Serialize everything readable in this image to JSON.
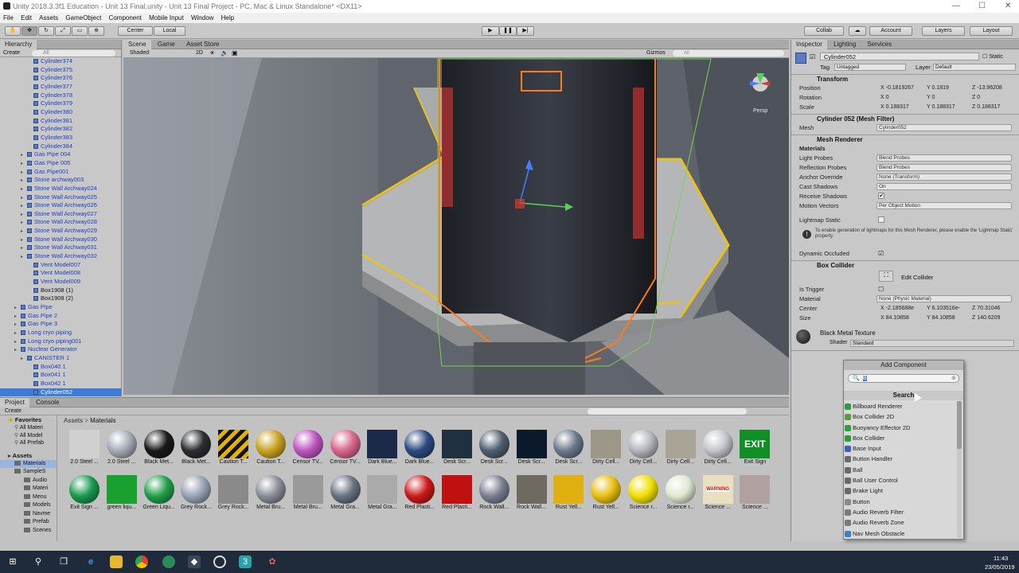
{
  "window": {
    "title": "Unity 2018.3.3f1 Education - Unit 13 Final.unity - Unit 13 Final Project - PC, Mac & Linux Standalone* <DX11>"
  },
  "menu": [
    "File",
    "Edit",
    "Assets",
    "GameObject",
    "Component",
    "Mobile Input",
    "Window",
    "Help"
  ],
  "toolbar": {
    "pivot": "Center",
    "space": "Local",
    "collab": "Collab",
    "account": "Account",
    "layers": "Layers",
    "layout": "Layout"
  },
  "hierarchy": {
    "tab": "Hierarchy",
    "create": "Create",
    "search_placeholder": "All",
    "items": [
      {
        "label": "Cylinder374",
        "indent": 3
      },
      {
        "label": "Cylinder375",
        "indent": 3
      },
      {
        "label": "Cylinder376",
        "indent": 3
      },
      {
        "label": "Cylinder377",
        "indent": 3
      },
      {
        "label": "Cylinder378",
        "indent": 3
      },
      {
        "label": "Cylinder379",
        "indent": 3
      },
      {
        "label": "Cylinder380",
        "indent": 3
      },
      {
        "label": "Cylinder381",
        "indent": 3
      },
      {
        "label": "Cylinder382",
        "indent": 3
      },
      {
        "label": "Cylinder383",
        "indent": 3
      },
      {
        "label": "Cylinder384",
        "indent": 3
      },
      {
        "label": "Gas Pipe 004",
        "indent": 2
      },
      {
        "label": "Gas Pipe 005",
        "indent": 2
      },
      {
        "label": "Gas Pipe001",
        "indent": 2
      },
      {
        "label": "Stone archway003",
        "indent": 2
      },
      {
        "label": "Stone Wall Archway024",
        "indent": 2
      },
      {
        "label": "Stone Wall Archway025",
        "indent": 2
      },
      {
        "label": "Stone Wall Archway026",
        "indent": 2
      },
      {
        "label": "Stone Wall Archway027",
        "indent": 2
      },
      {
        "label": "Stone Wall Archway028",
        "indent": 2
      },
      {
        "label": "Stone Wall Archway029",
        "indent": 2
      },
      {
        "label": "Stone Wall Archway030",
        "indent": 2
      },
      {
        "label": "Stone Wall Archway031",
        "indent": 2
      },
      {
        "label": "Stone Wall Archway032",
        "indent": 2
      },
      {
        "label": "Vent Model007",
        "indent": 3
      },
      {
        "label": "Vent Model008",
        "indent": 3
      },
      {
        "label": "Vent Model009",
        "indent": 3
      },
      {
        "label": "Box1908 (1)",
        "indent": 3
      },
      {
        "label": "Box1908 (2)",
        "indent": 3
      },
      {
        "label": "Gas Pipe",
        "indent": 1
      },
      {
        "label": "Gas Pipe 2",
        "indent": 1
      },
      {
        "label": "Gas Pipe 3",
        "indent": 1
      },
      {
        "label": "Long cryo piping",
        "indent": 1
      },
      {
        "label": "Long cryo piping001",
        "indent": 1
      },
      {
        "label": "Nuclear Generator",
        "indent": 1
      },
      {
        "label": "CANISTER 1",
        "indent": 2
      },
      {
        "label": "Box040 1",
        "indent": 3
      },
      {
        "label": "Box041 1",
        "indent": 3
      },
      {
        "label": "Box042 1",
        "indent": 3
      },
      {
        "label": "Cylinder052",
        "indent": 3
      }
    ]
  },
  "scene": {
    "tabs": [
      "Scene",
      "Game",
      "Asset Store"
    ],
    "shading": "Shaded",
    "mode2d": "2D",
    "gizmos": "Gizmos",
    "search_placeholder": "All",
    "persp": "Persp"
  },
  "project": {
    "tabs": [
      "Project",
      "Console"
    ],
    "create": "Create",
    "breadcrumb_root": "Assets",
    "breadcrumb_sep": ">",
    "breadcrumb_current": "Materials",
    "favorites_label": "Favorites",
    "favorites": [
      "All Materi",
      "All Model",
      "All Prefab"
    ],
    "assets_label": "Assets",
    "asset_folders": [
      "Materials",
      "SampleS",
      "Audio",
      "Materi",
      "Menu",
      "Models",
      "Navme",
      "Prefab",
      "Scenes"
    ],
    "materials_row1": [
      {
        "label": "2.0 Steel ...",
        "color": "#d0d0d0"
      },
      {
        "label": "2.0 Steel ...",
        "color": "#a6acb5"
      },
      {
        "label": "Black Met...",
        "color": "#1a1a1a"
      },
      {
        "label": "Black Met...",
        "color": "#2b2d31"
      },
      {
        "label": "Caution T...",
        "color": "#e0b400"
      },
      {
        "label": "Caution T...",
        "color": "#c9a320"
      },
      {
        "label": "Censor TV...",
        "color": "#c056c0"
      },
      {
        "label": "Censor TV...",
        "color": "#d9668c"
      },
      {
        "label": "Dark Blue...",
        "color": "#1c2a4a"
      },
      {
        "label": "Dark Blue...",
        "color": "#2c4a80"
      },
      {
        "label": "Desk Scr...",
        "color": "#203040"
      },
      {
        "label": "Desk Scr...",
        "color": "#506070"
      },
      {
        "label": "Desk Scr...",
        "color": "#0a1a2a"
      },
      {
        "label": "Desk Scr...",
        "color": "#6b7a8c"
      },
      {
        "label": "Dirty Cell...",
        "color": "#9c9888"
      },
      {
        "label": "Dirty Cell...",
        "color": "#b4b6bc"
      },
      {
        "label": "Dirty Cell...",
        "color": "#a8a596"
      },
      {
        "label": "Dirty Cell...",
        "color": "#c4c6cc"
      },
      {
        "label": "Exit Sign",
        "color": "#0f8f24"
      }
    ],
    "materials_row2": [
      {
        "label": "Exit Sign ...",
        "color": "#1a9a50"
      },
      {
        "label": "green liqu...",
        "color": "#1aa030"
      },
      {
        "label": "Green Liqu...",
        "color": "#22a04a"
      },
      {
        "label": "Grey Rock...",
        "color": "#9aa2b4"
      },
      {
        "label": "Grey Rock...",
        "color": "#8a8a8a"
      },
      {
        "label": "Metal Bru...",
        "color": "#8a8e96"
      },
      {
        "label": "Metal Bru...",
        "color": "#9a9a9a"
      },
      {
        "label": "Metal Gra...",
        "color": "#6a7282"
      },
      {
        "label": "Metal Gra...",
        "color": "#aaaaaa"
      },
      {
        "label": "Red Plasti...",
        "color": "#cc1a1a"
      },
      {
        "label": "Red Plasti...",
        "color": "#c01010"
      },
      {
        "label": "Rock Wall...",
        "color": "#7a8090"
      },
      {
        "label": "Rock Wall...",
        "color": "#6e6a62"
      },
      {
        "label": "Rust Yell...",
        "color": "#e0b010"
      },
      {
        "label": "Rust Yell...",
        "color": "#e8c010"
      },
      {
        "label": "Science r...",
        "color": "#f0e000"
      },
      {
        "label": "Science r...",
        "color": "#e0e8d0"
      },
      {
        "label": "Science ...",
        "color": "#e8e0c0"
      },
      {
        "label": "Science ...",
        "color": "#b0a0a0"
      }
    ],
    "exit_label": "EXIT",
    "warning_label": "WARNING"
  },
  "inspector": {
    "tabs": [
      "Inspector",
      "Lighting",
      "Services"
    ],
    "object_name": "Cylinder052",
    "static_label": "Static",
    "tag_label": "Tag",
    "tag_value": "Untagged",
    "layer_label": "Layer",
    "layer_value": "Default",
    "transform": {
      "title": "Transform",
      "position": {
        "label": "Position",
        "x": "-0.1819267",
        "y": "0.1819",
        "z": "-13.96208"
      },
      "rotation": {
        "label": "Rotation",
        "x": "0",
        "y": "0",
        "z": "0"
      },
      "scale": {
        "label": "Scale",
        "x": "0.188317",
        "y": "0.188317",
        "z": "0.188317"
      }
    },
    "mesh_filter": {
      "title": "Cylinder 052 (Mesh Filter)",
      "mesh_label": "Mesh",
      "mesh_value": "Cylinder052"
    },
    "mesh_renderer": {
      "title": "Mesh Renderer",
      "materials_label": "Materials",
      "rows": [
        {
          "label": "Light Probes",
          "value": "Blend Probes"
        },
        {
          "label": "Reflection Probes",
          "value": "Blend Probes"
        },
        {
          "label": "Anchor Override",
          "value": "None (Transform)"
        },
        {
          "label": "Cast Shadows",
          "value": "On"
        },
        {
          "label": "Receive Shadows",
          "value": "✔"
        },
        {
          "label": "Motion Vectors",
          "value": "Per Object Motion"
        },
        {
          "label": "Lightmap Static",
          "value": ""
        }
      ],
      "info": "To enable generation of lightmaps for this Mesh Renderer, please enable the 'Lightmap Static' property.",
      "dynamic_occluded_label": "Dynamic Occluded"
    },
    "box_collider": {
      "title": "Box Collider",
      "edit_collider": "Edit Collider",
      "is_trigger_label": "Is Trigger",
      "material_label": "Material",
      "material_value": "None (Physic Material)",
      "center": {
        "label": "Center",
        "x": "-2.185688e",
        "y": "6.103516e-",
        "z": "70.31046"
      },
      "size": {
        "label": "Size",
        "x": "84.10858",
        "y": "84.10858",
        "z": "140.6209"
      }
    },
    "material": {
      "name": "Black Metal Texture",
      "shader_label": "Shader",
      "shader_value": "Standard"
    },
    "add_component": "Add Component"
  },
  "add_component_popup": {
    "title": "Add Component",
    "search_value": "B",
    "header": "Search",
    "items": [
      {
        "label": "Billboard Renderer",
        "color": "#2e9a3a"
      },
      {
        "label": "Box Collider 2D",
        "color": "#5a9a3a"
      },
      {
        "label": "Buoyancy Effector 2D",
        "color": "#2ea040"
      },
      {
        "label": "Box Collider",
        "color": "#2e9a3a"
      },
      {
        "label": "Base Input",
        "color": "#4060c0"
      },
      {
        "label": "Button Handler",
        "color": "#6a6a6a"
      },
      {
        "label": "Ball",
        "color": "#6a6a6a"
      },
      {
        "label": "Ball User Control",
        "color": "#6a6a6a"
      },
      {
        "label": "Brake Light",
        "color": "#6a6a6a"
      },
      {
        "label": "Button",
        "color": "#8a8a8a"
      },
      {
        "label": "Audio Reverb Filter",
        "color": "#7a7a7a"
      },
      {
        "label": "Audio Reverb Zone",
        "color": "#7a7a7a"
      },
      {
        "label": "Nav Mesh Obstacle",
        "color": "#4080c0"
      }
    ]
  },
  "taskbar": {
    "time": "11:43",
    "date": "23/05/2019"
  }
}
